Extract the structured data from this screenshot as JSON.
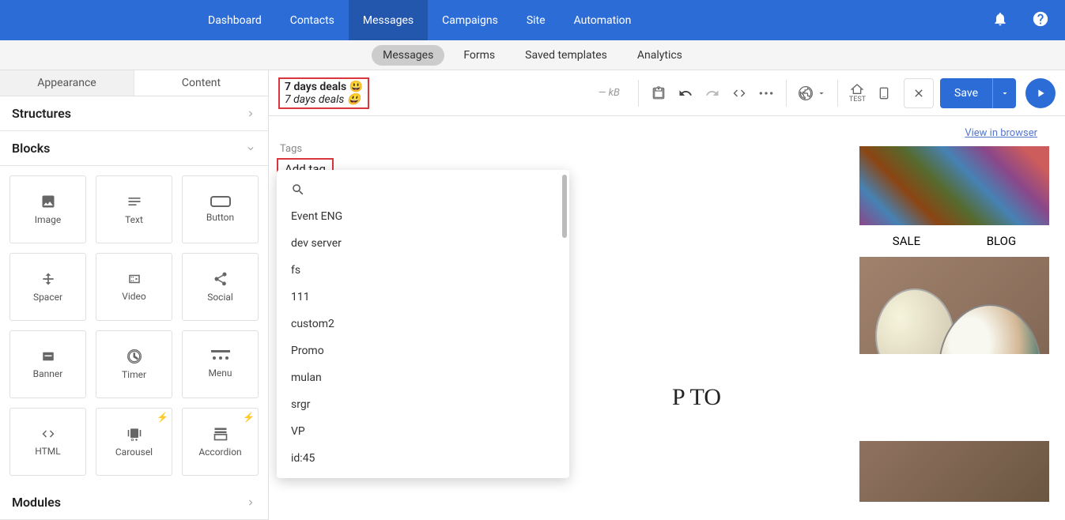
{
  "nav": {
    "items": [
      "Dashboard",
      "Contacts",
      "Messages",
      "Campaigns",
      "Site",
      "Automation"
    ],
    "active_index": 2
  },
  "subnav": {
    "items": [
      "Messages",
      "Forms",
      "Saved templates",
      "Analytics"
    ],
    "active_index": 0
  },
  "left_panel": {
    "tabs": [
      "Appearance",
      "Content"
    ],
    "structures_label": "Structures",
    "blocks_label": "Blocks",
    "modules_label": "Modules",
    "blocks": [
      {
        "label": "Image",
        "icon": "image"
      },
      {
        "label": "Text",
        "icon": "text"
      },
      {
        "label": "Button",
        "icon": "button"
      },
      {
        "label": "Spacer",
        "icon": "spacer"
      },
      {
        "label": "Video",
        "icon": "video"
      },
      {
        "label": "Social",
        "icon": "share"
      },
      {
        "label": "Banner",
        "icon": "banner"
      },
      {
        "label": "Timer",
        "icon": "timer"
      },
      {
        "label": "Menu",
        "icon": "menu"
      },
      {
        "label": "HTML",
        "icon": "code"
      },
      {
        "label": "Carousel",
        "icon": "carousel",
        "lightning": true
      },
      {
        "label": "Accordion",
        "icon": "accordion",
        "lightning": true
      }
    ]
  },
  "toolbar": {
    "title_line1": "7 days deals 😃",
    "title_line2": "7 days deals 😃",
    "kb_label": "— kB",
    "test_label": "TEST",
    "save_label": "Save"
  },
  "canvas": {
    "browser_link": "View in browser",
    "preview_nav": [
      "SALE",
      "BLOG"
    ],
    "preview_box_text": "P TO"
  },
  "tags": {
    "label": "Tags",
    "add_tag_label": "Add tag",
    "dropdown_items": [
      "Event ENG",
      "dev server",
      "fs",
      "111",
      "custom2",
      "Promo",
      "mulan",
      "srgr",
      "VP",
      "id:45"
    ]
  }
}
